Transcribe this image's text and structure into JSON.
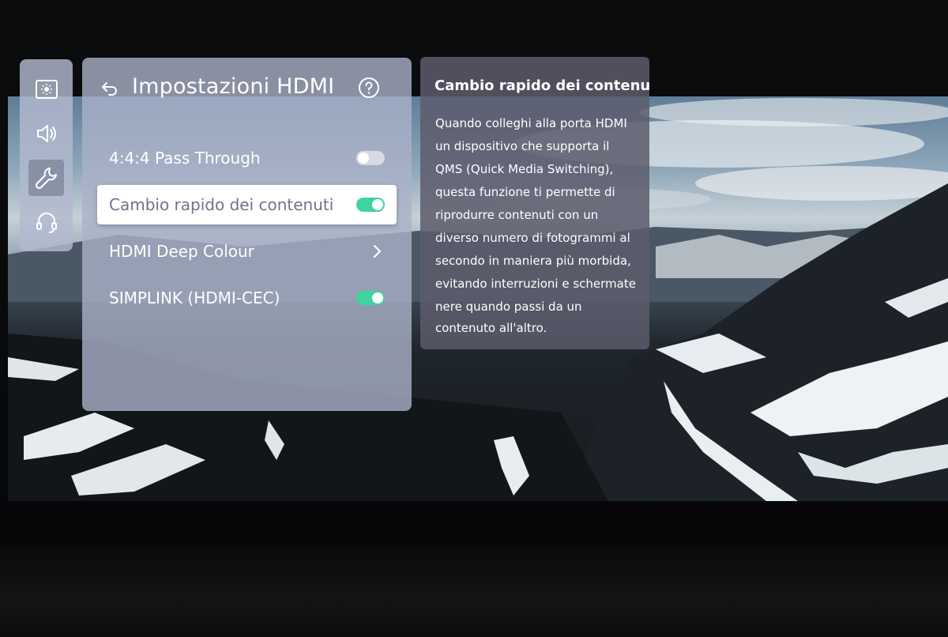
{
  "sidebar": {
    "items": [
      {
        "icon": "picture-icon"
      },
      {
        "icon": "sound-icon"
      },
      {
        "icon": "wrench-icon",
        "active": true
      },
      {
        "icon": "headset-icon"
      }
    ]
  },
  "panel": {
    "title": "Impostazioni HDMI",
    "items": [
      {
        "label": "4:4:4 Pass Through",
        "control": "toggle",
        "state": "off"
      },
      {
        "label": "Cambio rapido dei contenuti",
        "control": "toggle",
        "state": "on",
        "selected": true
      },
      {
        "label": "HDMI Deep Colour",
        "control": "chevron"
      },
      {
        "label": "SIMPLINK (HDMI-CEC)",
        "control": "toggle",
        "state": "on"
      }
    ]
  },
  "help": {
    "title": "Cambio rapido dei contenuti",
    "lines": [
      "Quando colleghi alla porta HDMI",
      "un dispositivo che supporta il",
      "QMS (Quick Media Switching),",
      "questa funzione ti permette di",
      "riprodurre contenuti con un",
      "diverso numero di fotogrammi al",
      "secondo in maniera più morbida,",
      "evitando interruzioni e schermate",
      "nere quando passi da un",
      "contenuto all'altro."
    ]
  },
  "colors": {
    "toggle_on": "#3fd3a0",
    "toggle_off": "#d7dae4",
    "panel_bg": "#aab1c8",
    "help_bg": "#5c5c6c"
  }
}
